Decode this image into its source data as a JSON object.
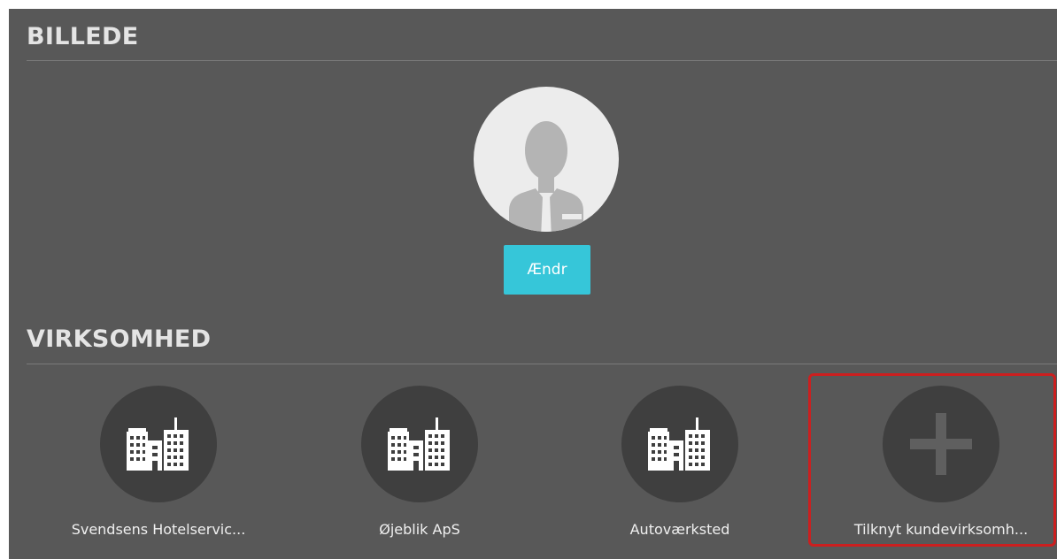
{
  "picture_section": {
    "title": "BILLEDE",
    "change_button_label": "Ændr"
  },
  "company_section": {
    "title": "VIRKSOMHED",
    "companies": [
      {
        "label": "Svendsens Hotelservic...",
        "icon": "buildings-icon"
      },
      {
        "label": "Øjeblik ApS",
        "icon": "buildings-icon"
      },
      {
        "label": "Autoværksted",
        "icon": "buildings-icon"
      }
    ],
    "add_company_label": "Tilknyt kundevirksomh...",
    "add_company_icon": "plus-icon"
  },
  "colors": {
    "panel_background": "#585858",
    "accent": "#36c6d9",
    "circle_background": "#3f3f3f",
    "highlight_border": "#cc1f1f"
  }
}
